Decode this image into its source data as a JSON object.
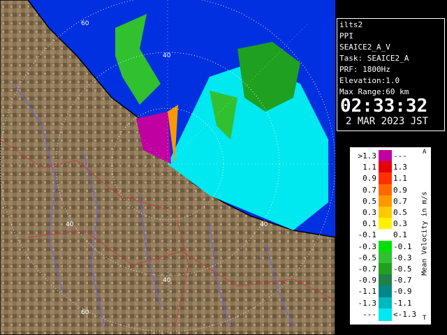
{
  "info": {
    "station": "ilts2",
    "mode": "PPI",
    "scan": "SEAICE2_A_V",
    "task": "Task: SEAICE2_A",
    "prf": "PRF: 1800Hz",
    "elevation": "Elevation:1.0",
    "max_range": "Max Range:60 km",
    "time": "02:33:32",
    "date": "2 MAR 2023 JST"
  },
  "legend": {
    "unit_label": "Mean Velocity in m/s",
    "up_glyph": "A",
    "down_glyph": "T",
    "rows": [
      {
        "left": ">1.3",
        "right": "---",
        "color": "#c000a0"
      },
      {
        "left": "1.1",
        "right": "1.3",
        "color": "#e80000"
      },
      {
        "left": "0.9",
        "right": "1.1",
        "color": "#ff3000"
      },
      {
        "left": "0.7",
        "right": "0.9",
        "color": "#ff6800"
      },
      {
        "left": "0.5",
        "right": "0.7",
        "color": "#ff9800"
      },
      {
        "left": "0.3",
        "right": "0.5",
        "color": "#ffc800"
      },
      {
        "left": "0.1",
        "right": "0.3",
        "color": "#fff000"
      },
      {
        "left": "-0.1",
        "right": "0.1",
        "color": "#ffffff"
      },
      {
        "left": "-0.3",
        "right": "-0.1",
        "color": "#00e000"
      },
      {
        "left": "-0.5",
        "right": "-0.3",
        "color": "#30c030"
      },
      {
        "left": "-0.7",
        "right": "-0.5",
        "color": "#20a020"
      },
      {
        "left": "-0.9",
        "right": "-0.7",
        "color": "#208048"
      },
      {
        "left": "-1.1",
        "right": "-0.9",
        "color": "#008888"
      },
      {
        "left": "-1.3",
        "right": "-1.1",
        "color": "#00b8c0"
      },
      {
        "left": "---",
        "right": "<-1.3",
        "color": "#00e8f0"
      }
    ]
  },
  "map": {
    "range_labels": [
      "60",
      "40",
      "40",
      "40",
      "40",
      "60"
    ],
    "colors": {
      "land": "#8a7454",
      "sea": "#0030e0",
      "ring": "#ffffff",
      "coast": "#000000",
      "river": "#6060ff",
      "border": "#c04040"
    }
  }
}
